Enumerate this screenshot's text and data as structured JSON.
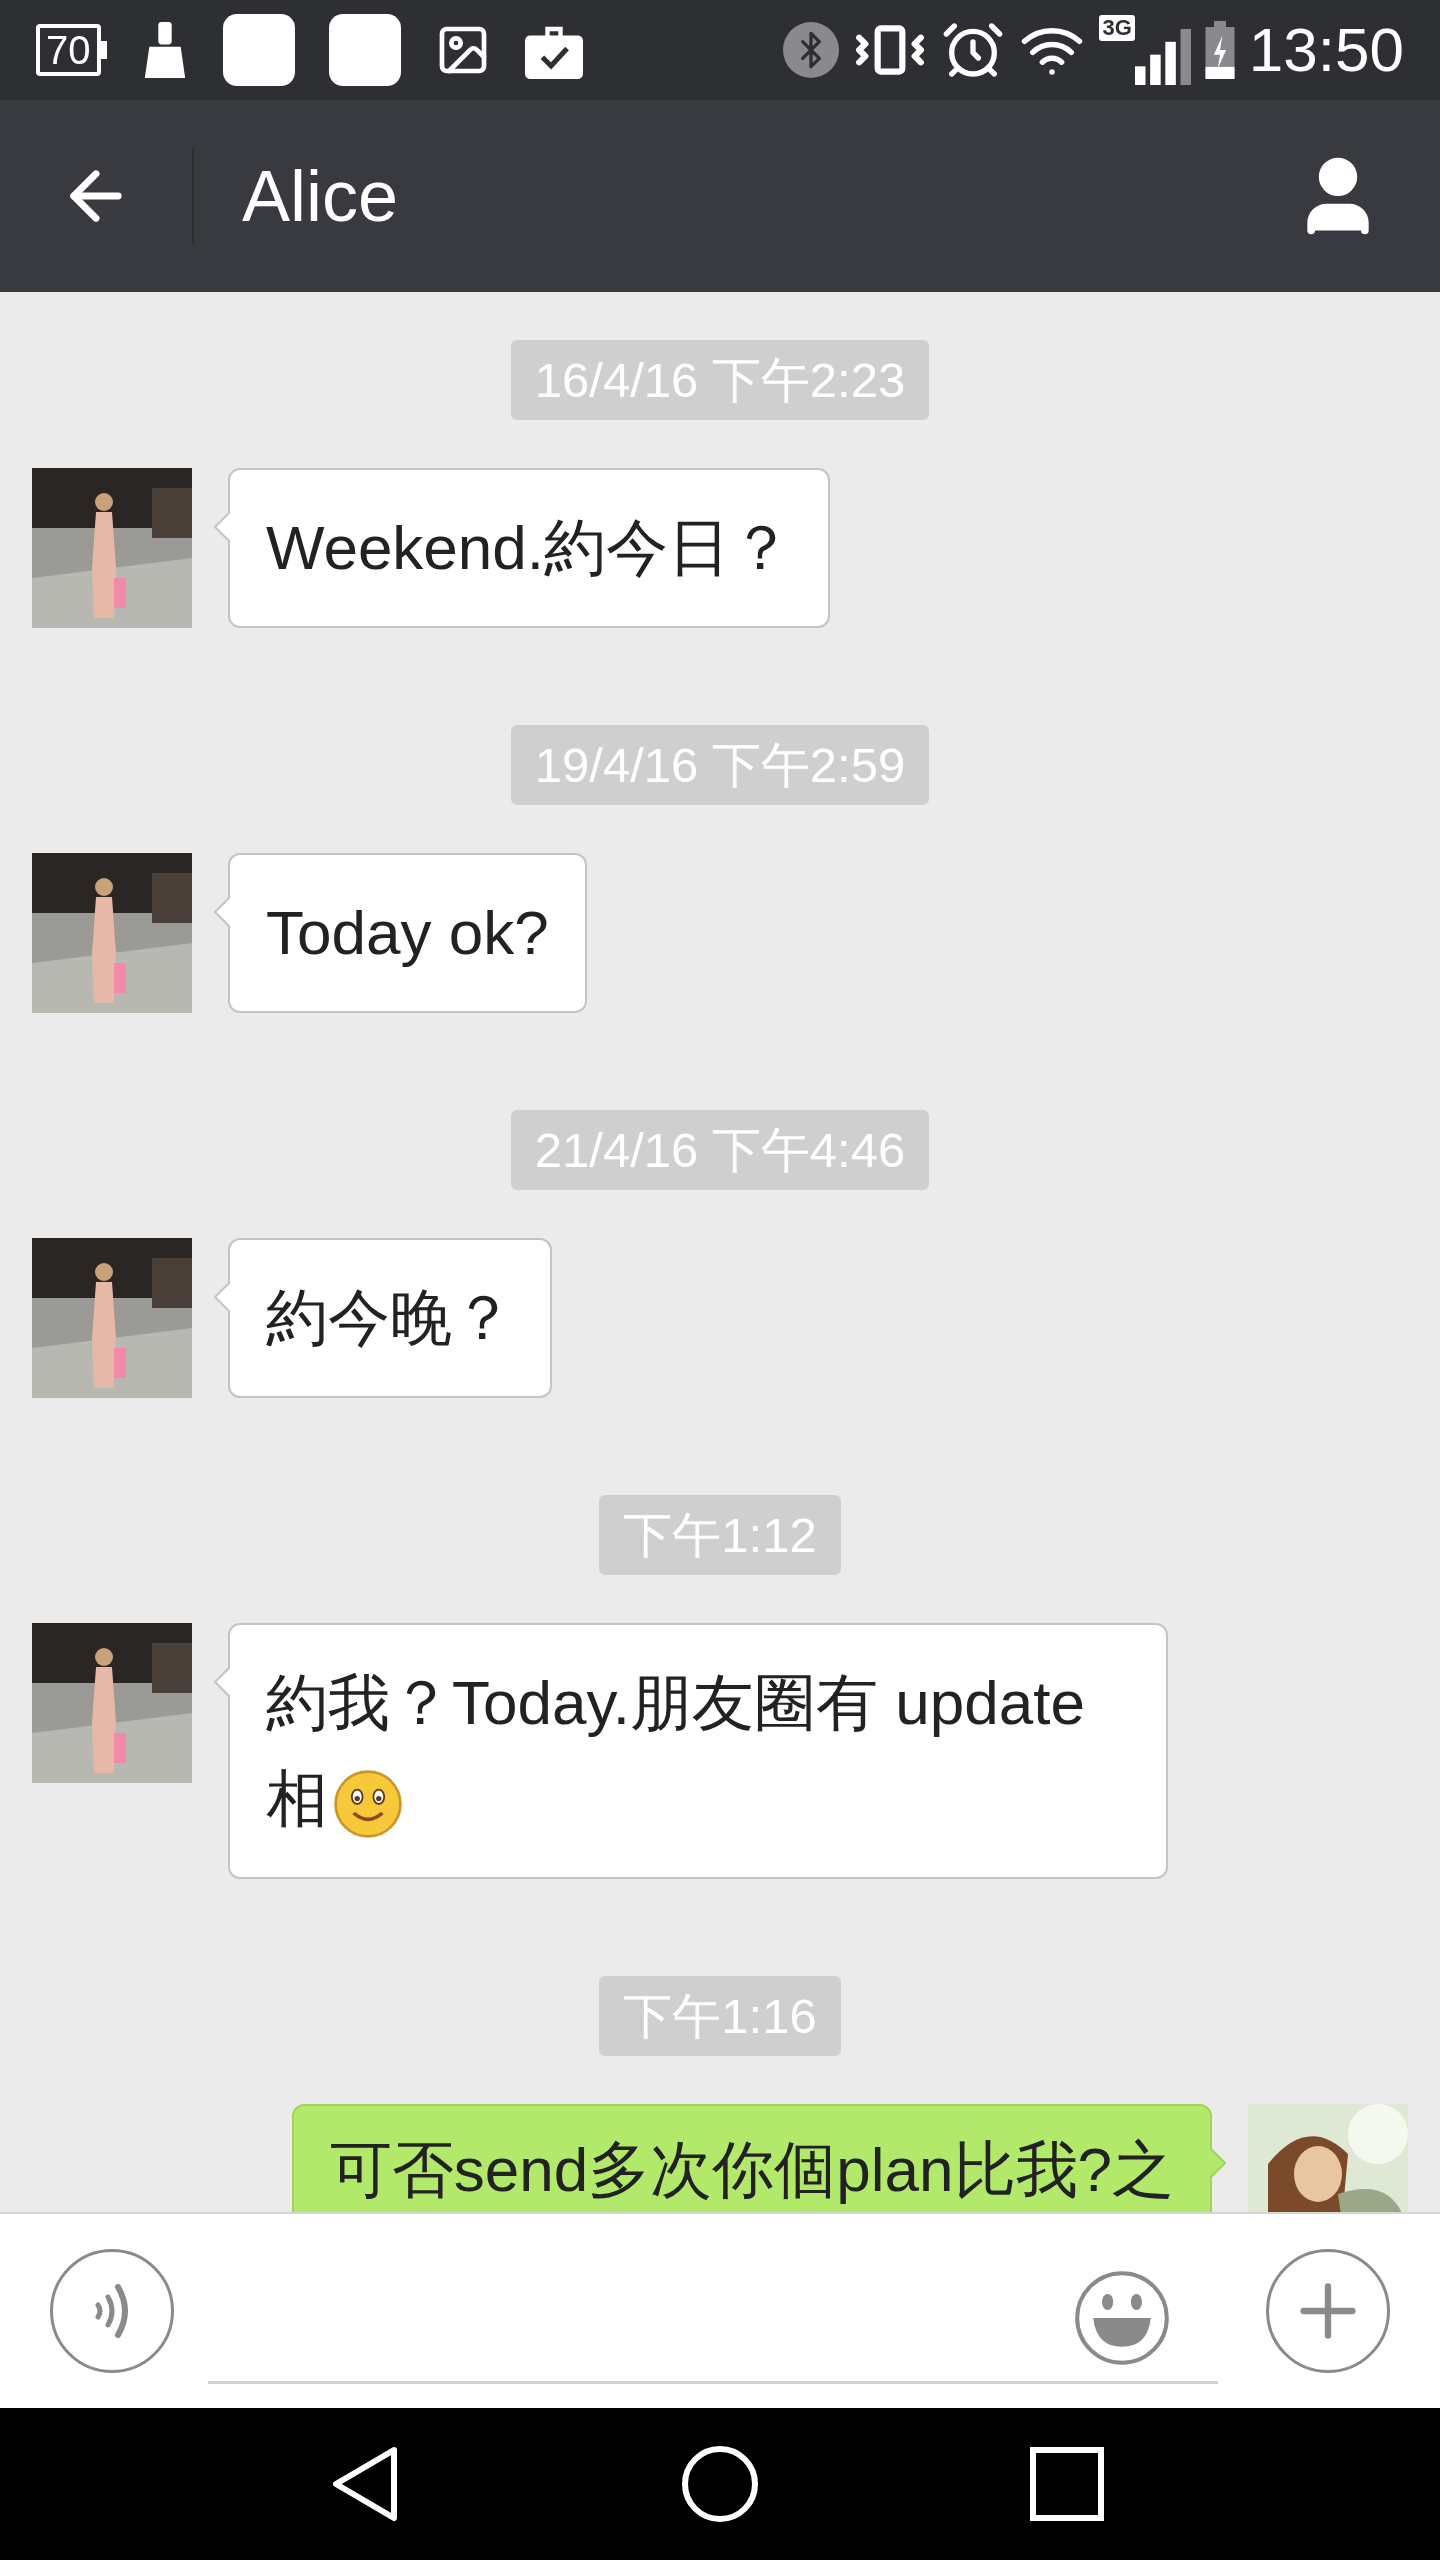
{
  "status_bar": {
    "battery_text": "70",
    "network": "3G",
    "time": "13:50"
  },
  "header": {
    "title": "Alice"
  },
  "messages": [
    {
      "kind": "timestamp",
      "text": "16/4/16 下午2:23"
    },
    {
      "kind": "received",
      "text": "Weekend.約今日？"
    },
    {
      "kind": "timestamp",
      "text": "19/4/16 下午2:59"
    },
    {
      "kind": "received",
      "text": "Today ok?"
    },
    {
      "kind": "timestamp",
      "text": "21/4/16 下午4:46"
    },
    {
      "kind": "received",
      "text": "約今晚？"
    },
    {
      "kind": "timestamp",
      "text": "下午1:12"
    },
    {
      "kind": "received",
      "text": "約我？Today.朋友圈有 update 相",
      "emoji_after": true
    },
    {
      "kind": "timestamp",
      "text": "下午1:16"
    },
    {
      "kind": "sent",
      "text": "可否send多次你個plan比我?之"
    }
  ]
}
